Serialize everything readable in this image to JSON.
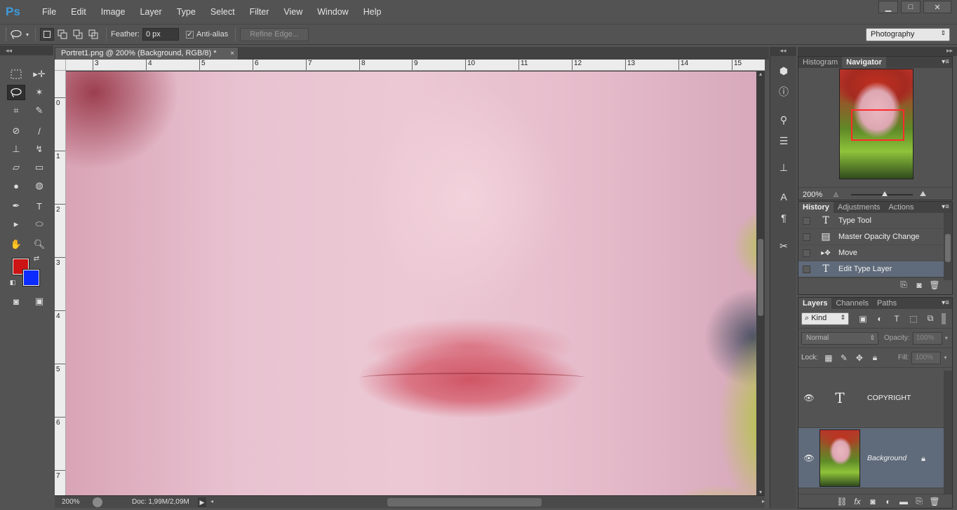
{
  "app": {
    "logo": "Ps",
    "menu": [
      "File",
      "Edit",
      "Image",
      "Layer",
      "Type",
      "Select",
      "Filter",
      "View",
      "Window",
      "Help"
    ],
    "window_controls": {
      "minimize": "▁",
      "maximize": "□",
      "close": "✕"
    }
  },
  "options_bar": {
    "feather_label": "Feather:",
    "feather_value": "0 px",
    "anti_alias_label": "Anti-alias",
    "anti_alias_checked": true,
    "refine_edge_label": "Refine Edge...",
    "workspace": "Photography"
  },
  "toolbox": {
    "foreground_color": "#cc1414",
    "background_color": "#0b2bff",
    "active_tool": "lasso"
  },
  "document": {
    "tab_title": "Portret1.png @ 200% (Background, RGB/8) *",
    "close_glyph": "×",
    "ruler_h": [
      "3",
      "4",
      "5",
      "6",
      "7",
      "8",
      "9",
      "10",
      "11",
      "12",
      "13",
      "14",
      "15"
    ],
    "ruler_v": [
      "0",
      "1",
      "2",
      "3",
      "4",
      "5",
      "6",
      "7"
    ],
    "status_zoom": "200%",
    "status_doc": "Doc: 1,99M/2,09M"
  },
  "navigator": {
    "tabs": [
      "Histogram",
      "Navigator"
    ],
    "active_tab": "Navigator",
    "zoom": "200%",
    "zoom_slider_fraction": 0.55
  },
  "history": {
    "tabs": [
      "History",
      "Adjustments",
      "Actions"
    ],
    "active_tab": "History",
    "items": [
      {
        "label": "Type Tool",
        "icon": "type-icon",
        "glyph": "T"
      },
      {
        "label": "Master Opacity Change",
        "icon": "document-icon",
        "glyph": "▤"
      },
      {
        "label": "Move",
        "icon": "move-icon",
        "glyph": "▸✥"
      },
      {
        "label": "Edit Type Layer",
        "icon": "type-icon",
        "glyph": "T"
      }
    ],
    "selected_index": 3
  },
  "layers": {
    "tabs": [
      "Layers",
      "Channels",
      "Paths"
    ],
    "active_tab": "Layers",
    "filter_kind": "Kind",
    "blend_mode": "Normal",
    "opacity_label": "Opacity:",
    "opacity_value": "100%",
    "lock_label": "Lock:",
    "fill_label": "Fill:",
    "fill_value": "100%",
    "items": [
      {
        "name": "COPYRIGHT",
        "type": "text",
        "visible": true
      },
      {
        "name": "Background",
        "type": "image",
        "visible": true,
        "locked": true
      }
    ],
    "selected_index": 1
  }
}
